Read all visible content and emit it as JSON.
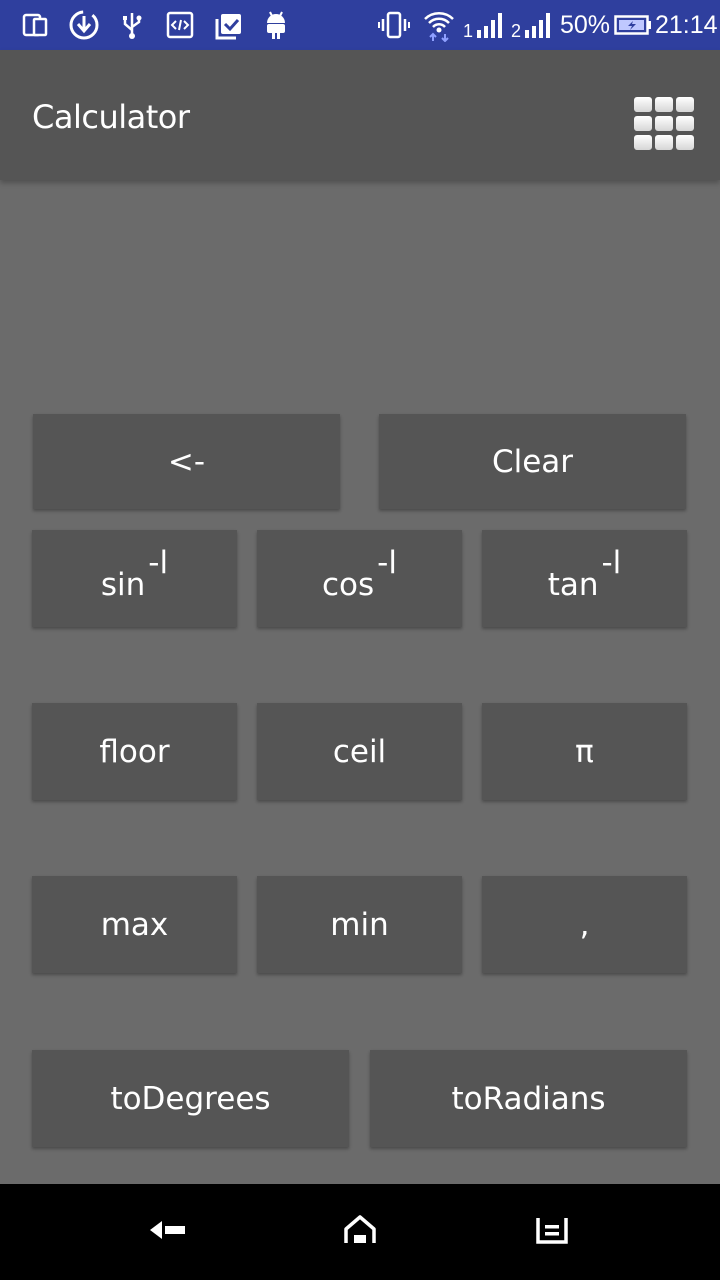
{
  "status_bar": {
    "battery_percent": "50%",
    "time": "21:14",
    "sim1_label": "1",
    "sim2_label": "2",
    "icons": [
      "dual-screen-icon",
      "sync-icon",
      "usb-icon",
      "developer-icon",
      "clipboard-check-icon",
      "android-icon",
      "vibrate-icon",
      "wifi-icon",
      "signal-icon",
      "battery-icon"
    ]
  },
  "app_bar": {
    "title": "Calculator"
  },
  "keys": {
    "backspace": "<-",
    "clear": "Clear",
    "sin_inv": "sin",
    "cos_inv": "cos",
    "tan_inv": "tan",
    "inverse_sup": "-l",
    "floor": "floor",
    "ceil": "ceil",
    "pi": "π",
    "max": "max",
    "min": "min",
    "comma": ",",
    "to_degrees": "toDegrees",
    "to_radians": "toRadians"
  },
  "colors": {
    "status_bar": "#2f3f9e",
    "app_bar": "#555555",
    "background": "#6b6b6b",
    "key": "#555555",
    "nav_bar": "#000000"
  }
}
